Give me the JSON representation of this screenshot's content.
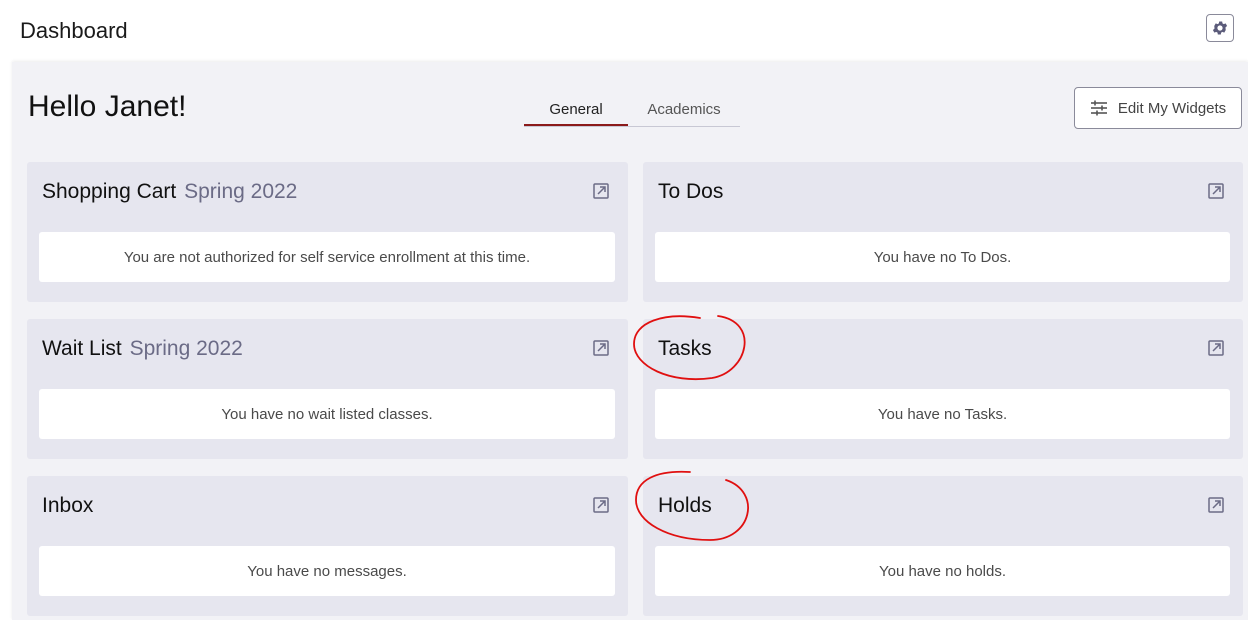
{
  "header": {
    "title": "Dashboard",
    "settings_icon": "gear-icon"
  },
  "main": {
    "greeting": "Hello Janet!",
    "tabs": [
      {
        "label": "General",
        "active": true
      },
      {
        "label": "Academics",
        "active": false
      }
    ],
    "edit_widgets_label": "Edit My Widgets",
    "edit_widgets_icon": "sliders-icon",
    "accent_color": "#8b1a1a"
  },
  "widgets": [
    {
      "title": "Shopping Cart",
      "term": "Spring 2022",
      "message": "You are not authorized for self service enrollment at this time.",
      "icon": "open-external-icon"
    },
    {
      "title": "To Dos",
      "term": "",
      "message": "You have no To Dos.",
      "icon": "open-external-icon"
    },
    {
      "title": "Wait List",
      "term": "Spring 2022",
      "message": "You have no wait listed classes.",
      "icon": "open-external-icon"
    },
    {
      "title": "Tasks",
      "term": "",
      "message": "You have no Tasks.",
      "icon": "open-external-icon"
    },
    {
      "title": "Inbox",
      "term": "",
      "message": "You have no messages.",
      "icon": "open-external-icon"
    },
    {
      "title": "Holds",
      "term": "",
      "message": "You have no holds.",
      "icon": "open-external-icon"
    }
  ],
  "annotations": {
    "circle_color": "#e01010",
    "circled_items": [
      "Tasks",
      "Holds"
    ]
  }
}
